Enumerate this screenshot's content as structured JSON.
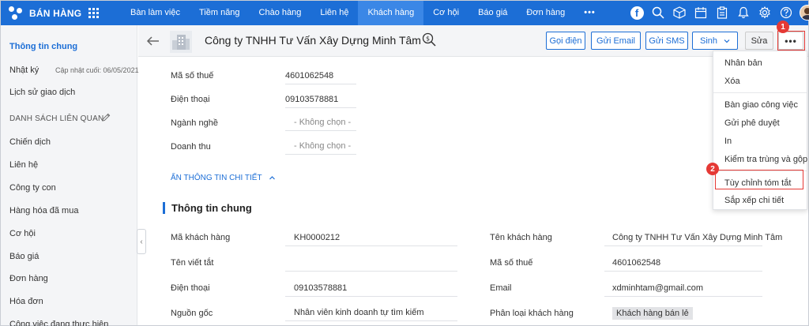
{
  "app": {
    "brand": "BÁN HÀNG"
  },
  "nav": {
    "items": [
      "Bàn làm việc",
      "Tiềm năng",
      "Chào hàng",
      "Liên hệ",
      "Khách hàng",
      "Cơ hội",
      "Báo giá",
      "Đơn hàng"
    ],
    "active": "Khách hàng",
    "more_label": "•••"
  },
  "top_icons": [
    "facebook-icon",
    "search-icon",
    "cube-icon",
    "calendar-icon",
    "clipboard-icon",
    "bell-icon",
    "gear-icon",
    "help-icon",
    "avatar"
  ],
  "sidebar": {
    "general": "Thông tin chung",
    "log": "Nhật ký",
    "last_update": "Cập nhật cuối: 06/05/2021",
    "history": "Lịch sử giao dịch",
    "related_header": "DANH SÁCH LIÊN QUAN",
    "items": [
      "Chiến dịch",
      "Liên hệ",
      "Công ty con",
      "Hàng hóa đã mua",
      "Cơ hội",
      "Báo giá",
      "Đơn hàng",
      "Hóa đơn",
      "Công việc đang thực hiện"
    ]
  },
  "header": {
    "title": "Công ty TNHH Tư Vấn Xây Dựng Minh Tâm",
    "call_label": "Gọi điện",
    "email_label": "Gửi Email",
    "sms_label": "Gửi SMS",
    "generate_label": "Sinh",
    "edit_label": "Sửa",
    "more_label": "•••"
  },
  "detail_top": {
    "tax_label": "Mã số thuế",
    "tax_value": "4601062548",
    "phone_label": "Điện thoại",
    "phone_value": "09103578881",
    "industry_label": "Ngành nghề",
    "industry_value": "- Không chọn -",
    "revenue_label": "Doanh thu",
    "revenue_value": "- Không chọn -"
  },
  "toggle_details": "ẨN THÔNG TIN CHI TIẾT",
  "section": {
    "title": "Thông tin chung",
    "customer_code_label": "Mã khách hàng",
    "customer_code": "KH0000212",
    "short_name_label": "Tên viết tắt",
    "short_name": "",
    "phone_label": "Điện thoại",
    "phone": "09103578881",
    "source_label": "Nguồn gốc",
    "source": "Nhân viên kinh doanh tự tìm kiếm",
    "customer_name_label": "Tên khách hàng",
    "customer_name": "Công ty TNHH Tư Vấn Xây Dựng Minh Tâm",
    "tax_label": "Mã số thuế",
    "tax": "4601062548",
    "email_label": "Email",
    "email": "xdminhtam@gmail.com",
    "category_label": "Phân loại khách hàng",
    "category": "Khách hàng bán lẻ"
  },
  "menu": {
    "duplicate": "Nhân bản",
    "delete": "Xóa",
    "handover": "Bàn giao công việc",
    "send_approval": "Gửi phê duyệt",
    "print": "In",
    "check_duplicates": "Kiểm tra trùng và gộp",
    "customize_summary": "Tùy chỉnh tóm tắt",
    "arrange_details": "Sắp xếp chi tiết"
  },
  "annotations": {
    "step1": "1",
    "step2": "2"
  },
  "colors": {
    "primary": "#1c6ed6",
    "highlight": "#e53935"
  }
}
